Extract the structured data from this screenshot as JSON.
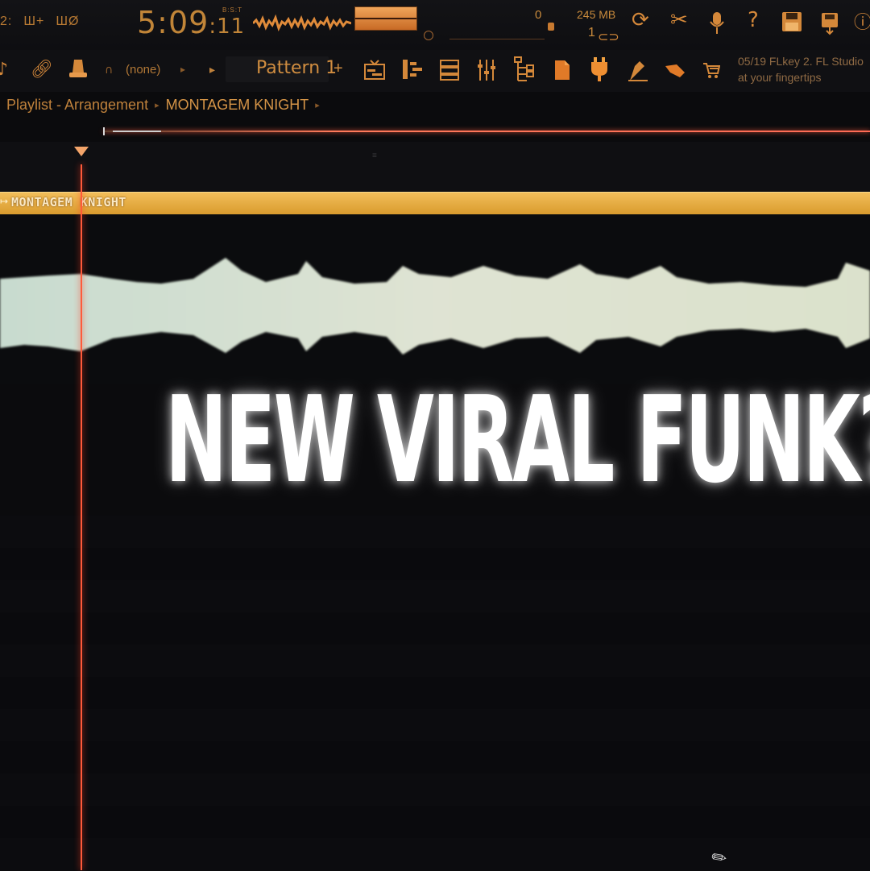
{
  "toolbar": {
    "left_icons": [
      "2:",
      "Ш+",
      "ШØ"
    ],
    "time_main": "5:09",
    "time_frac": "11",
    "time_mode": "B:S:T",
    "cpu_value": "0",
    "memory": "245 MB",
    "polyphony": "1",
    "icons": [
      "lips-icon",
      "refresh-icon",
      "scissors-icon",
      "microphone-icon",
      "help-icon",
      "save-icon",
      "render-icon",
      "info-icon"
    ]
  },
  "toolbar2": {
    "snap_value": "(none)",
    "pattern_label": "Pattern 1",
    "pattern_add": "+",
    "hint_line1": "05/19  FLkey 2. FL Studio",
    "hint_line2": "at your fingertips"
  },
  "breadcrumb": {
    "root": "Playlist - Arrangement",
    "current": "MONTAGEM KNIGHT"
  },
  "clip": {
    "name": "MONTAGEM KNIGHT"
  },
  "overlay": {
    "headline": "NEW VIRAL FUNK?"
  },
  "colors": {
    "accent": "#d4883a",
    "clip": "#e6ad45",
    "playhead": "#ff5a3a",
    "waveform": "#e6f2dc"
  }
}
